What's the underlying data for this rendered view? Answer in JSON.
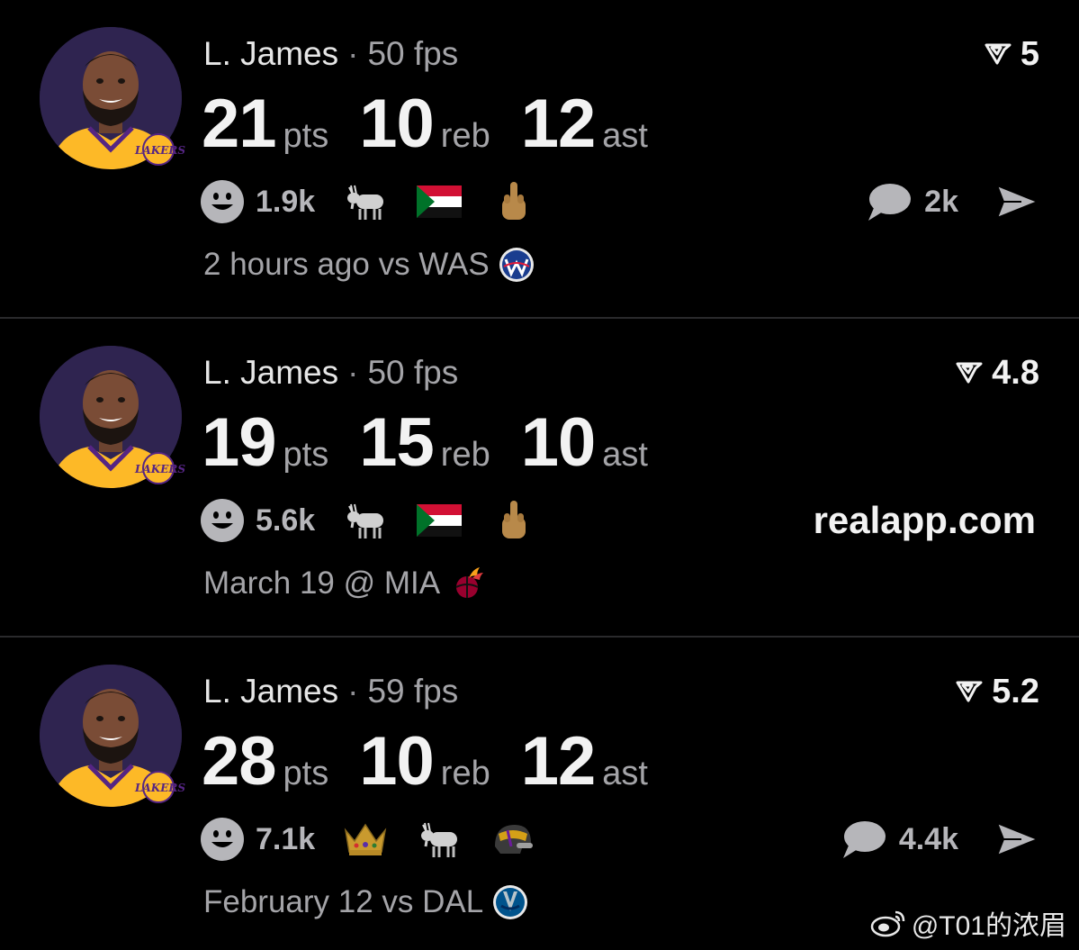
{
  "feed": [
    {
      "player": "L. James",
      "separator": "·",
      "fps": "50 fps",
      "rating": "5",
      "stats": [
        {
          "value": "21",
          "unit": "pts"
        },
        {
          "value": "10",
          "unit": "reb"
        },
        {
          "value": "12",
          "unit": "ast"
        }
      ],
      "reaction_count": "1.9k",
      "reaction_icons": [
        "goat-icon",
        "sudan-flag-icon",
        "middle-finger-icon"
      ],
      "comment_count": "2k",
      "time_text": "2 hours ago vs WAS",
      "opponent_logo": "wizards-logo-icon"
    },
    {
      "player": "L. James",
      "separator": "·",
      "fps": "50 fps",
      "rating": "4.8",
      "stats": [
        {
          "value": "19",
          "unit": "pts"
        },
        {
          "value": "15",
          "unit": "reb"
        },
        {
          "value": "10",
          "unit": "ast"
        }
      ],
      "reaction_count": "5.6k",
      "reaction_icons": [
        "goat-icon",
        "sudan-flag-icon",
        "middle-finger-icon"
      ],
      "site_text": "realapp.com",
      "time_text": "March 19 @ MIA",
      "opponent_logo": "heat-logo-icon"
    },
    {
      "player": "L. James",
      "separator": "·",
      "fps": "59 fps",
      "rating": "5.2",
      "stats": [
        {
          "value": "28",
          "unit": "pts"
        },
        {
          "value": "10",
          "unit": "reb"
        },
        {
          "value": "12",
          "unit": "ast"
        }
      ],
      "reaction_count": "7.1k",
      "reaction_icons": [
        "crown-icon",
        "goat-icon",
        "helmet-icon"
      ],
      "comment_count": "4.4k",
      "time_text": "February 12 vs DAL",
      "opponent_logo": "mavericks-logo-icon"
    }
  ],
  "watermark": "@T01的浓眉",
  "colors": {
    "background": "#000000",
    "primary_text": "#f2f2f2",
    "secondary_text": "#a4a4a8",
    "divider": "#2a2a2c",
    "lakers_gold": "#fdb927",
    "lakers_purple": "#552583"
  }
}
